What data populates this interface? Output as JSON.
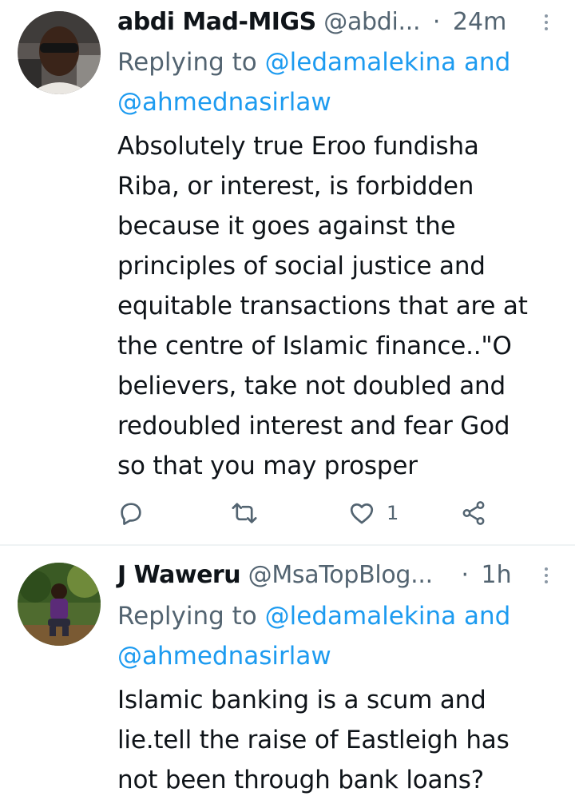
{
  "tweets": [
    {
      "display_name": "abdi Mad-MIGS",
      "handle": "@abdi...",
      "separator": "·",
      "time": "24m",
      "replying_prefix": "Replying to",
      "mention_1": "@ledamalekina",
      "conjunction": "and",
      "mention_2": "@ahmednasirlaw",
      "text_lines": [
        "Absolutely true  Eroo fundisha",
        "Riba, or interest, is forbidden",
        "because it goes against the",
        "principles of social justice and",
        "equitable transactions that are at",
        "the centre of Islamic finance..\"O",
        "believers, take not doubled and",
        "redoubled interest and fear God",
        "so that you may prosper"
      ],
      "like_count": "1",
      "icons": [
        "reply-icon",
        "retweet-icon",
        "like-icon",
        "share-icon",
        "more-icon"
      ]
    },
    {
      "display_name": "J Waweru",
      "handle": "@MsaTopBlog...",
      "separator": "·",
      "time": "1h",
      "replying_prefix": "Replying to",
      "mention_1": "@ledamalekina",
      "conjunction": "and",
      "mention_2": "@ahmednasirlaw",
      "text_lines": [
        "Islamic banking is a scum and",
        "lie.tell the raise of Eastleigh has",
        "not been through bank loans?"
      ],
      "icons": [
        "more-icon"
      ]
    }
  ],
  "colors": {
    "text_primary": "#0f1419",
    "text_secondary": "#536471",
    "link": "#1d9bf0",
    "divider": "#eff3f4"
  }
}
